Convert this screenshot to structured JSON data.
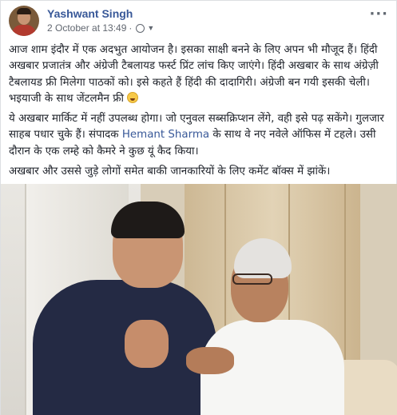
{
  "post": {
    "author_name": "Yashwant Singh",
    "timestamp": "2 October at 13:49",
    "meta_separator": "·",
    "privacy_icon": "globe-icon",
    "more_options_label": "···",
    "paragraphs": [
      {
        "text": "आज शाम इंदौर में एक अदभुत आयोजन है। इसका साक्षी बनने के लिए अपन भी मौजूद हैं। हिंदी अखबार प्रजातंत्र और अंग्रेजी टैबलायड फर्स्ट प्रिंट लांच किए जाएंगे। हिंदी अखबार के साथ अंग्रेज़ी टैबलायड फ्री मिलेगा पाठकों को। इसे कहते हैं हिंदी की दादागिरी। अंग्रेजी बन गयी इसकी चेली। भइयाजी के साथ जेंटलमैन फ्री"
      },
      {
        "text_before_link": "ये अखबार मार्किट में नहीं उपलब्ध होगा। जो एनुवल सब्सक्रिप्शन लेंगे, वही इसे पढ़ सकेंगे। गुलजार साहब पधार चुके हैं। संपादक ",
        "link_text": "Hemant Sharma",
        "text_after_link": " के साथ वे नए नवेले ऑफिस में टहले। उसी दौरान के एक लम्हे को कैमरे ने कुछ यूं कैद किया।"
      },
      {
        "text": "अखबार और उससे जुड़े लोगों समेत बाकी जानकारियों के लिए कमेंट बॉक्स में झांकें।"
      }
    ],
    "emoji_icon": "laughing-emoji-icon"
  },
  "colors": {
    "author_link": "#385898",
    "text": "#1d2129",
    "meta": "#616770"
  }
}
